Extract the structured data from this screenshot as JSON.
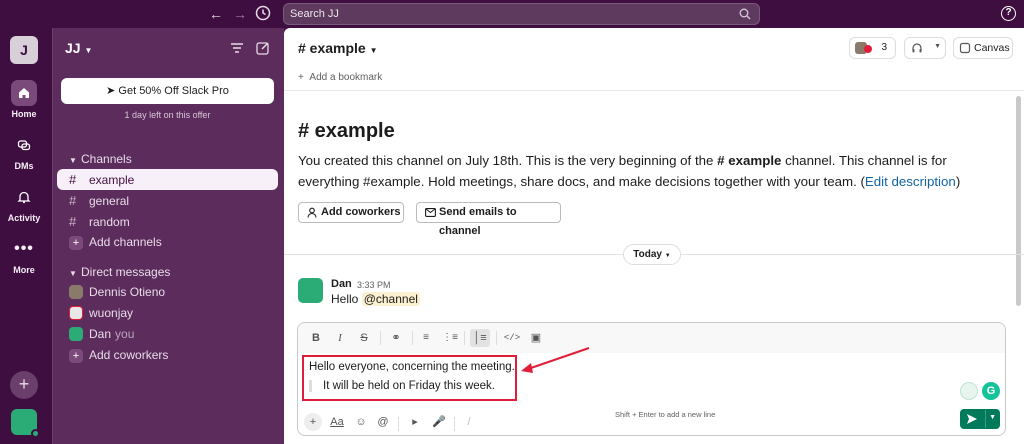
{
  "topbar": {
    "search_placeholder": "Search JJ",
    "help_label": "?"
  },
  "rail": {
    "workspace_initial": "J",
    "items": [
      {
        "label": "Home",
        "icon": "home-icon"
      },
      {
        "label": "DMs",
        "icon": "dms-icon"
      },
      {
        "label": "Activity",
        "icon": "bell-icon"
      },
      {
        "label": "More",
        "icon": "more-icon"
      }
    ]
  },
  "sidebar": {
    "workspace_name": "JJ",
    "promo_button": "Get 50% Off Slack Pro",
    "promo_note": "1 day left on this offer",
    "channels_header": "Channels",
    "channels": [
      "example",
      "general",
      "random"
    ],
    "add_channels": "Add channels",
    "dm_header": "Direct messages",
    "dms": [
      {
        "name": "Dennis Otieno",
        "suffix": ""
      },
      {
        "name": "wuonjay",
        "suffix": ""
      },
      {
        "name": "Dan",
        "suffix": "you"
      }
    ],
    "add_coworkers": "Add coworkers"
  },
  "channel": {
    "title": "# example",
    "member_count": "3",
    "canvas_label": "Canvas",
    "add_bookmark": "Add a bookmark",
    "intro_title": "# example",
    "intro_part1": "You created this channel on July 18th. This is the very beginning of the ",
    "intro_bold": "# example",
    "intro_part2": " channel. This channel is for everything #example. Hold meetings, share docs, and make decisions together with your team. (",
    "intro_link": "Edit description",
    "intro_end": ")",
    "add_coworkers_button": "Add coworkers",
    "send_emails_button": "Send emails to channel",
    "day_divider": "Today"
  },
  "message": {
    "author": "Dan",
    "time": "3:33 PM",
    "text": "Hello ",
    "mention": "@channel"
  },
  "composer": {
    "line1": "Hello everyone, concerning the meeting.",
    "line2": "It will be held on Friday this week.",
    "hint": "Shift + Enter to add a new line"
  },
  "colors": {
    "aubergine": "#3f0e40",
    "sidebar": "#5b2c5c",
    "accent_green": "#007a5a",
    "link": "#1264a3",
    "annotation_red": "#e01e3a"
  }
}
